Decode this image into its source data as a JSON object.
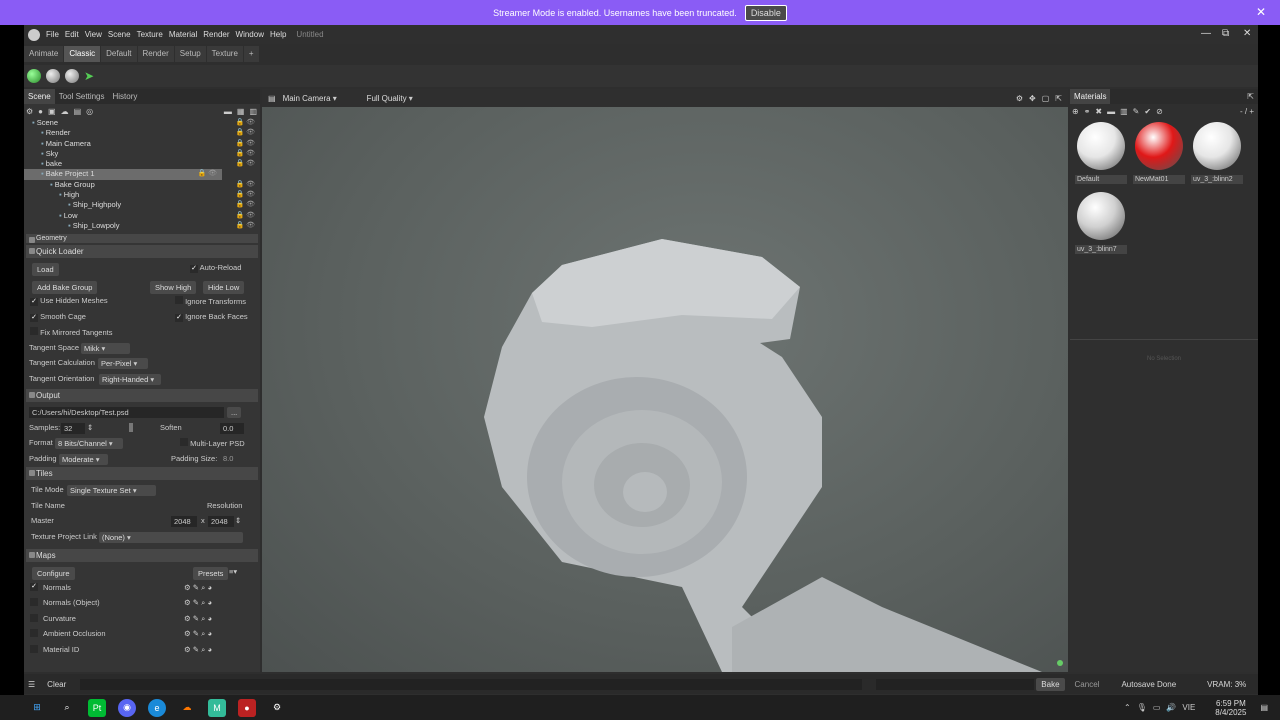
{
  "banner": {
    "message": "Streamer Mode is enabled. Usernames have been truncated.",
    "button": "Disable",
    "close": "✕"
  },
  "menu": [
    "File",
    "Edit",
    "View",
    "Scene",
    "Texture",
    "Material",
    "Render",
    "Window",
    "Help"
  ],
  "doc_title": "Untitled",
  "window_controls": {
    "min": "—",
    "max": "⧉",
    "close": "✕"
  },
  "tabs": [
    "Animate",
    "Classic",
    "Default",
    "Render",
    "Setup",
    "Texture",
    "+"
  ],
  "left_tabs": [
    "Scene",
    "Tool Settings",
    "History"
  ],
  "tree": [
    {
      "label": "Scene",
      "indent": 0
    },
    {
      "label": "Render",
      "indent": 1
    },
    {
      "label": "Main Camera",
      "indent": 1
    },
    {
      "label": "Sky",
      "indent": 1
    },
    {
      "label": "bake",
      "indent": 1
    },
    {
      "label": "Bake Project 1",
      "indent": 1,
      "selected": true
    },
    {
      "label": "Bake Group",
      "indent": 2
    },
    {
      "label": "High",
      "indent": 3
    },
    {
      "label": "Ship_Highpoly",
      "indent": 4
    },
    {
      "label": "Low",
      "indent": 3
    },
    {
      "label": "Ship_Lowpoly",
      "indent": 4
    }
  ],
  "geometry_label": "Geometry",
  "quick_loader": {
    "title": "Quick Loader",
    "load": "Load",
    "auto_reload": "Auto-Reload",
    "add_bake_group": "Add Bake Group",
    "show_high": "Show High",
    "hide_low": "Hide Low",
    "use_hidden_meshes": "Use Hidden Meshes",
    "ignore_transforms": "Ignore Transforms",
    "smooth_cage": "Smooth Cage",
    "ignore_back_faces": "Ignore Back Faces",
    "fix_mirrored": "Fix Mirrored Tangents",
    "tangent_space_label": "Tangent Space",
    "tangent_space": "Mikk",
    "tangent_calc_label": "Tangent Calculation",
    "tangent_calc": "Per-Pixel",
    "tangent_orient_label": "Tangent Orientation",
    "tangent_orient": "Right-Handed"
  },
  "output": {
    "title": "Output",
    "path": "C:/Users/hi/Desktop/Test.psd",
    "browse": "...",
    "samples_label": "Samples:",
    "samples": "32",
    "soften_label": "Soften",
    "soften": "0.0",
    "format_label": "Format",
    "format": "8 Bits/Channel",
    "multilayer": "Multi-Layer PSD",
    "padding_label": "Padding",
    "padding": "Moderate",
    "padding_size_label": "Padding Size:",
    "padding_size": "8.0"
  },
  "tiles": {
    "title": "Tiles",
    "tile_mode_label": "Tile Mode",
    "tile_mode": "Single Texture Set",
    "tile_name": "Tile Name",
    "resolution": "Resolution",
    "master": "Master",
    "res_w": "2048",
    "res_x": "x",
    "res_h": "2048",
    "link_label": "Texture Project Link",
    "link": "(None)"
  },
  "maps": {
    "title": "Maps",
    "configure": "Configure",
    "presets": "Presets",
    "items": [
      {
        "label": "Normals",
        "checked": true
      },
      {
        "label": "Normals (Object)",
        "checked": false
      },
      {
        "label": "Curvature",
        "checked": false
      },
      {
        "label": "Ambient Occlusion",
        "checked": false
      },
      {
        "label": "Material ID",
        "checked": false
      }
    ]
  },
  "viewport": {
    "camera": "Main Camera",
    "quality": "Full Quality"
  },
  "materials": {
    "title": "Materials",
    "counter": "- / +",
    "items": [
      {
        "label": "Default",
        "color": "#e6e6e6"
      },
      {
        "label": "NewMat01",
        "color": "#e01818"
      },
      {
        "label": "uv_3_:blinn2",
        "color": "#e6e6e6"
      },
      {
        "label": "uv_3_:blinn7",
        "color": "#d0d0d0"
      }
    ],
    "empty_text": "No Selection"
  },
  "status": {
    "clear": "Clear",
    "bake": "Bake",
    "cancel": "Cancel",
    "autosave": "Autosave Done",
    "vram": "VRAM: 3%"
  },
  "taskbar": {
    "lang": "VIE",
    "time": "6:59 PM",
    "date": "8/4/2025"
  }
}
